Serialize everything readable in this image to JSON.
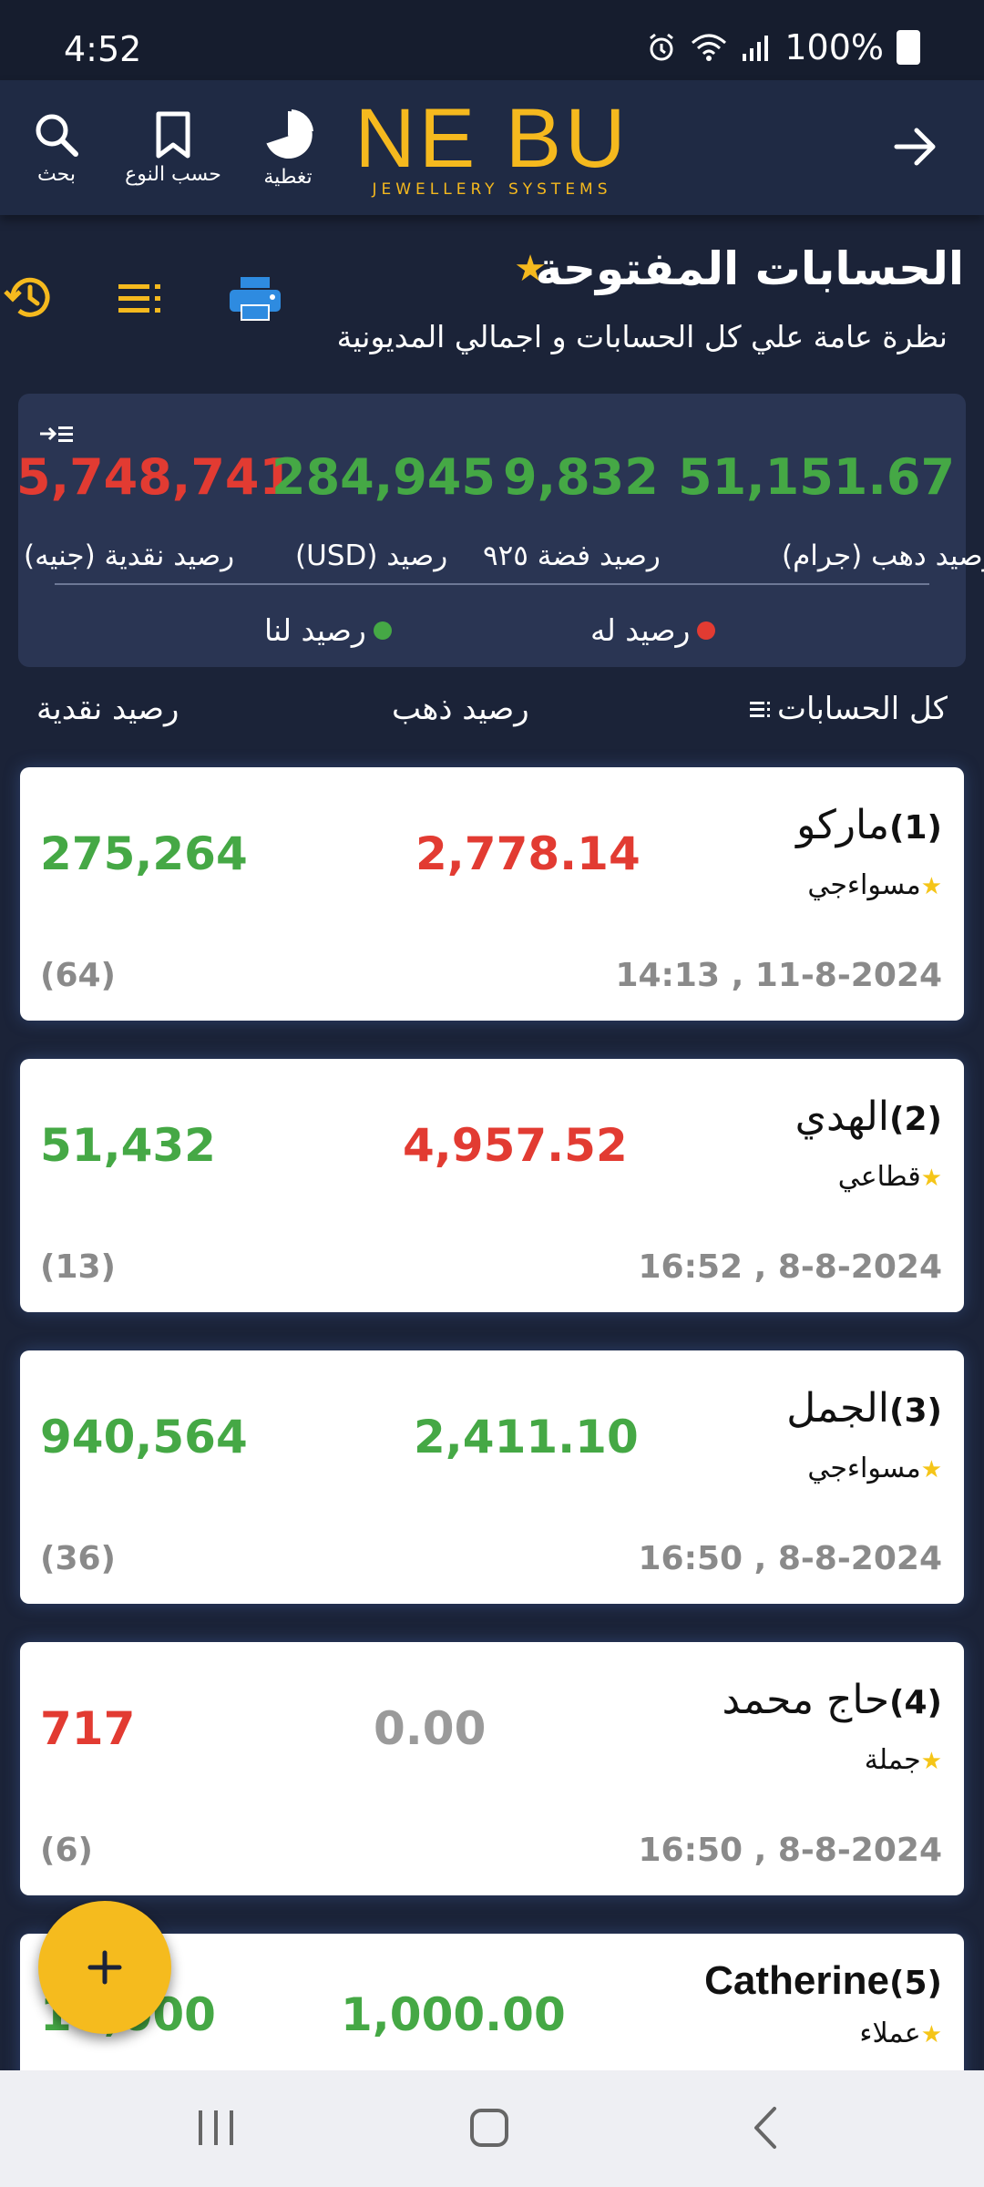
{
  "status_bar": {
    "time": "4:52",
    "battery": "100%"
  },
  "app_bar": {
    "search_label": "بحث",
    "by_type_label": "حسب النوع",
    "coverage_label": "تغطية",
    "logo_main": "NE BU",
    "logo_sub": "JEWELLERY SYSTEMS"
  },
  "header": {
    "title": "الحسابات المفتوحة",
    "subtitle": "نظرة عامة علي كل الحسابات و اجمالي المديونية"
  },
  "summary": {
    "values": {
      "cash": "5,748,741",
      "usd": "284,945",
      "silver": "9,832",
      "gold": "51,151.67"
    },
    "labels": {
      "cash": "رصيد نقدية (جنيه)",
      "usd": "رصيد (USD)",
      "silver": "رصيد فضة ٩٢٥",
      "gold": "رصيد دهب (جرام)"
    },
    "legend": {
      "for_us": "رصيد لنا",
      "for_him": "رصيد له"
    },
    "colors": {
      "positive": "#45a845",
      "negative": "#e23b32"
    }
  },
  "columns": {
    "all_accounts": "كل الحسابات",
    "gold_balance": "رصيد ذهب",
    "cash_balance": "رصيد نقدية"
  },
  "accounts": [
    {
      "num": "(1)",
      "name": "ماركو",
      "category": "مسواءجي",
      "gold": "2,778.14",
      "gold_status": "negative",
      "cash": "275,264",
      "cash_status": "positive",
      "date": "14:13 , 11-8-2024",
      "count": "(64)"
    },
    {
      "num": "(2)",
      "name": "الهدي",
      "category": "قطاعي",
      "gold": "4,957.52",
      "gold_status": "negative",
      "cash": "51,432",
      "cash_status": "positive",
      "date": "16:52 , 8-8-2024",
      "count": "(13)"
    },
    {
      "num": "(3)",
      "name": "الجمل",
      "category": "مسواءجي",
      "gold": "2,411.10",
      "gold_status": "positive",
      "cash": "940,564",
      "cash_status": "positive",
      "date": "16:50 , 8-8-2024",
      "count": "(36)"
    },
    {
      "num": "(4)",
      "name": "حاج محمد",
      "category": "جملة",
      "gold": "0.00",
      "gold_status": "zero",
      "cash": "717",
      "cash_status": "negative",
      "date": "16:50 , 8-8-2024",
      "count": "(6)"
    },
    {
      "num": "(5)",
      "name": "Catherine",
      "category": "عملاء",
      "gold": "1,000.00",
      "gold_status": "positive",
      "cash": "10,000",
      "cash_status": "positive",
      "date": "",
      "count": ""
    }
  ]
}
